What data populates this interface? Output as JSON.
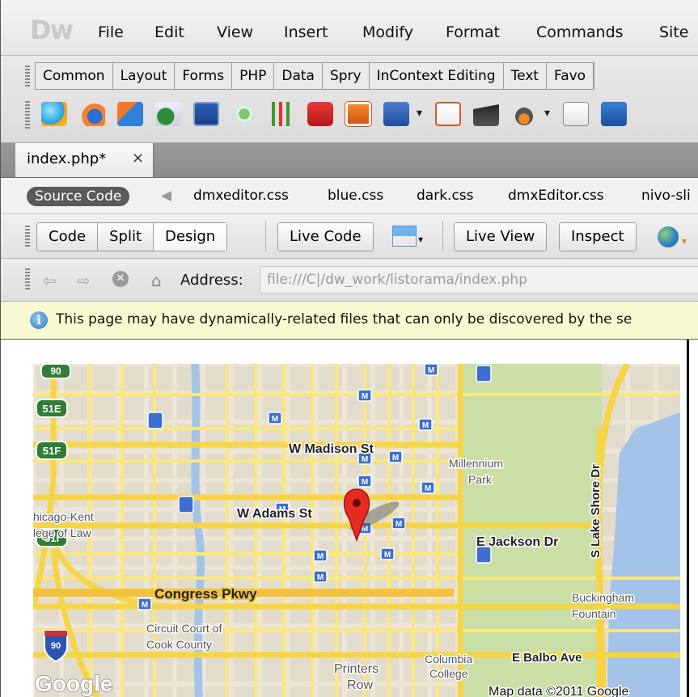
{
  "app": {
    "logo": "Dw"
  },
  "menu": [
    "File",
    "Edit",
    "View",
    "Insert",
    "Modify",
    "Format",
    "Commands",
    "Site"
  ],
  "insert_bar": {
    "tabs": [
      "Common",
      "Layout",
      "Forms",
      "PHP",
      "Data",
      "Spry",
      "InContext Editing",
      "Text",
      "Favo"
    ]
  },
  "document": {
    "tab_name": "index.php*",
    "close_glyph": "×"
  },
  "related_files": {
    "source_label": "Source Code",
    "files": [
      "dmxeditor.css",
      "blue.css",
      "dark.css",
      "dmxEditor.css",
      "nivo-sli"
    ]
  },
  "toolbar": {
    "code": "Code",
    "split": "Split",
    "design": "Design",
    "live_code": "Live Code",
    "live_view": "Live View",
    "inspect": "Inspect"
  },
  "address": {
    "label": "Address:",
    "value": "file:///C|/dw_work/listorama/index.php"
  },
  "info": {
    "message": "This page may have dynamically-related files that can only be discovered by the se"
  },
  "map": {
    "streets": {
      "madison": "W Madison St",
      "adams": "W Adams St",
      "jackson": "E Jackson Dr",
      "lakeshore": "S Lake Shore Dr",
      "congress": "Congress Pkwy",
      "balbo": "E Balbo Ave"
    },
    "places": {
      "millennium": "Millennium",
      "park": "Park",
      "kent1": "hicago-Kent",
      "kent2": "lege of Law",
      "circuit1": "Circuit Court of",
      "circuit2": "Cook County",
      "printers1": "Printers",
      "printers2": "Row",
      "columbia1": "Columbia",
      "columbia2": "College",
      "buckingham1": "Buckingham",
      "buckingham2": "Fountain"
    },
    "shields": [
      "90",
      "51E",
      "51F",
      "51I",
      "90"
    ],
    "logo": "Google",
    "attribution": "Map data ©2011 Google",
    "colors": {
      "land": "#ede6d6",
      "road": "#fbe879",
      "park": "#c9dfa5",
      "water": "#a4c3e8"
    }
  }
}
